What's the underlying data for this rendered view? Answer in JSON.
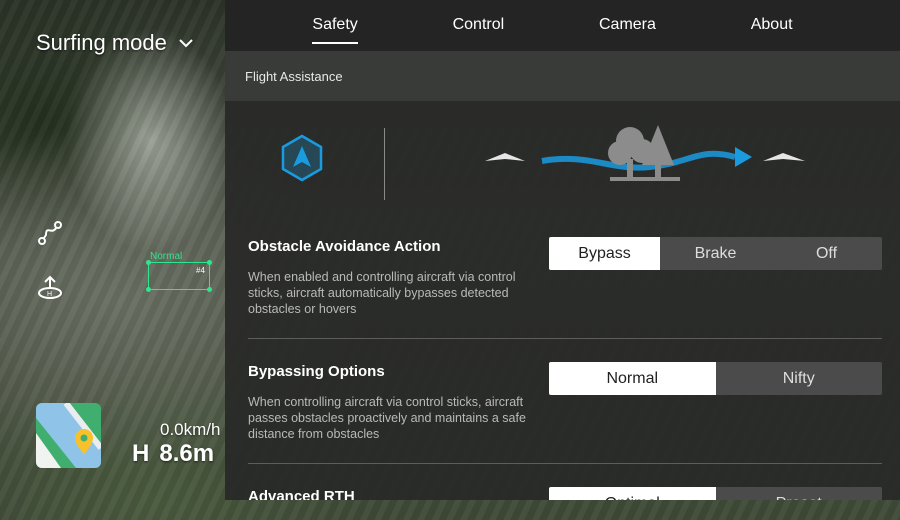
{
  "mode": {
    "label": "Surfing mode"
  },
  "tracking": {
    "label": "Normal",
    "id": "#4"
  },
  "telemetry": {
    "speed": "0.0km/h",
    "height_prefix": "H",
    "height": "8.6m"
  },
  "tabs": [
    {
      "label": "Safety",
      "active": true
    },
    {
      "label": "Control",
      "active": false
    },
    {
      "label": "Camera",
      "active": false
    },
    {
      "label": "About",
      "active": false
    }
  ],
  "section": {
    "title": "Flight Assistance"
  },
  "settings": {
    "obstacle": {
      "title": "Obstacle Avoidance Action",
      "description": "When enabled and controlling aircraft via control sticks, aircraft automatically bypasses detected obstacles or hovers",
      "options": [
        "Bypass",
        "Brake",
        "Off"
      ],
      "selected": "Bypass"
    },
    "bypassing": {
      "title": "Bypassing Options",
      "description": "When controlling aircraft via control  sticks, aircraft passes obstacles proactively and maintains a safe distance from obstacles",
      "options": [
        "Normal",
        "Nifty"
      ],
      "selected": "Normal"
    },
    "rth": {
      "title": "Advanced RTH",
      "options": [
        "Optimal",
        "Preset"
      ],
      "selected": "Optimal"
    }
  },
  "colors": {
    "accent": "#1a9be0",
    "tracking": "#2ee68e",
    "panel": "#282928"
  }
}
